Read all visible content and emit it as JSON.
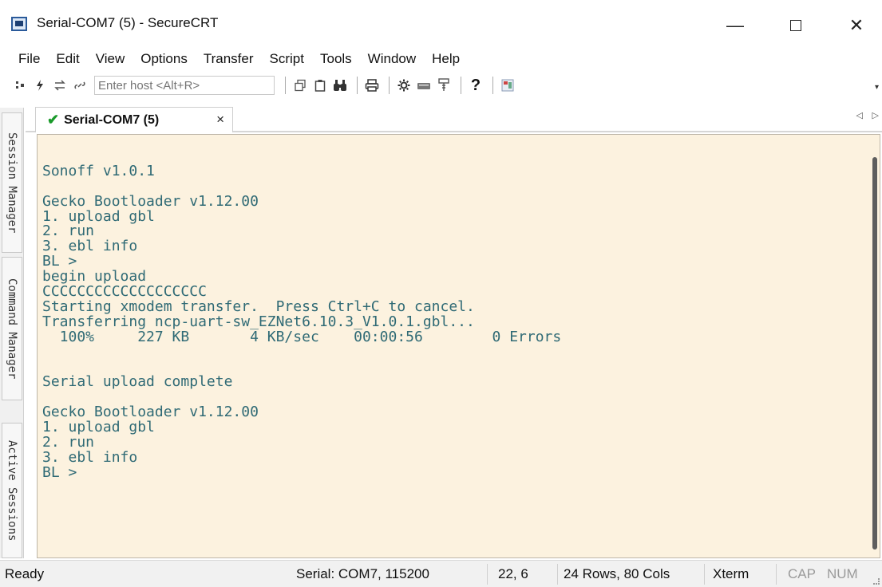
{
  "window": {
    "title": "Serial-COM7 (5) - SecureCRT",
    "minimize_glyph": "—",
    "close_glyph": "✕"
  },
  "menu": [
    "File",
    "Edit",
    "View",
    "Options",
    "Transfer",
    "Script",
    "Tools",
    "Window",
    "Help"
  ],
  "toolbar": {
    "host_placeholder": "Enter host <Alt+R>",
    "icons": [
      "connect-icon",
      "quick-connect-icon",
      "reconnect-icon",
      "disconnect-icon",
      "copy-icon",
      "paste-icon",
      "find-icon",
      "print-icon",
      "settings-icon",
      "keymap-icon",
      "sftp-icon",
      "help-icon",
      "script-icon"
    ],
    "help_glyph": "?"
  },
  "sidebar": {
    "tabs": [
      "Session Manager",
      "Command Manager",
      "Active Sessions"
    ]
  },
  "tab": {
    "label": "Serial-COM7 (5)",
    "check": "✔",
    "close": "×"
  },
  "terminal": {
    "lines": [
      "",
      "Sonoff v1.0.1",
      "",
      "Gecko Bootloader v1.12.00",
      "1. upload gbl",
      "2. run",
      "3. ebl info",
      "BL >",
      "begin upload",
      "CCCCCCCCCCCCCCCCCCC",
      "Starting xmodem transfer.  Press Ctrl+C to cancel.",
      "Transferring ncp-uart-sw_EZNet6.10.3_V1.0.1.gbl...",
      "  100%     227 KB       4 KB/sec    00:00:56        0 Errors",
      "",
      "",
      "Serial upload complete",
      "",
      "Gecko Bootloader v1.12.00",
      "1. upload gbl",
      "2. run",
      "3. ebl info",
      "BL >"
    ]
  },
  "status": {
    "state": "Ready",
    "connection": "Serial: COM7, 115200",
    "cursor": "22,  6",
    "size": "24 Rows, 80 Cols",
    "emulation": "Xterm",
    "cap": "CAP",
    "num": "NUM"
  },
  "colors": {
    "terminal_bg": "#fcf2df",
    "terminal_fg": "#2f6a75",
    "check_green": "#1a9a2a"
  }
}
